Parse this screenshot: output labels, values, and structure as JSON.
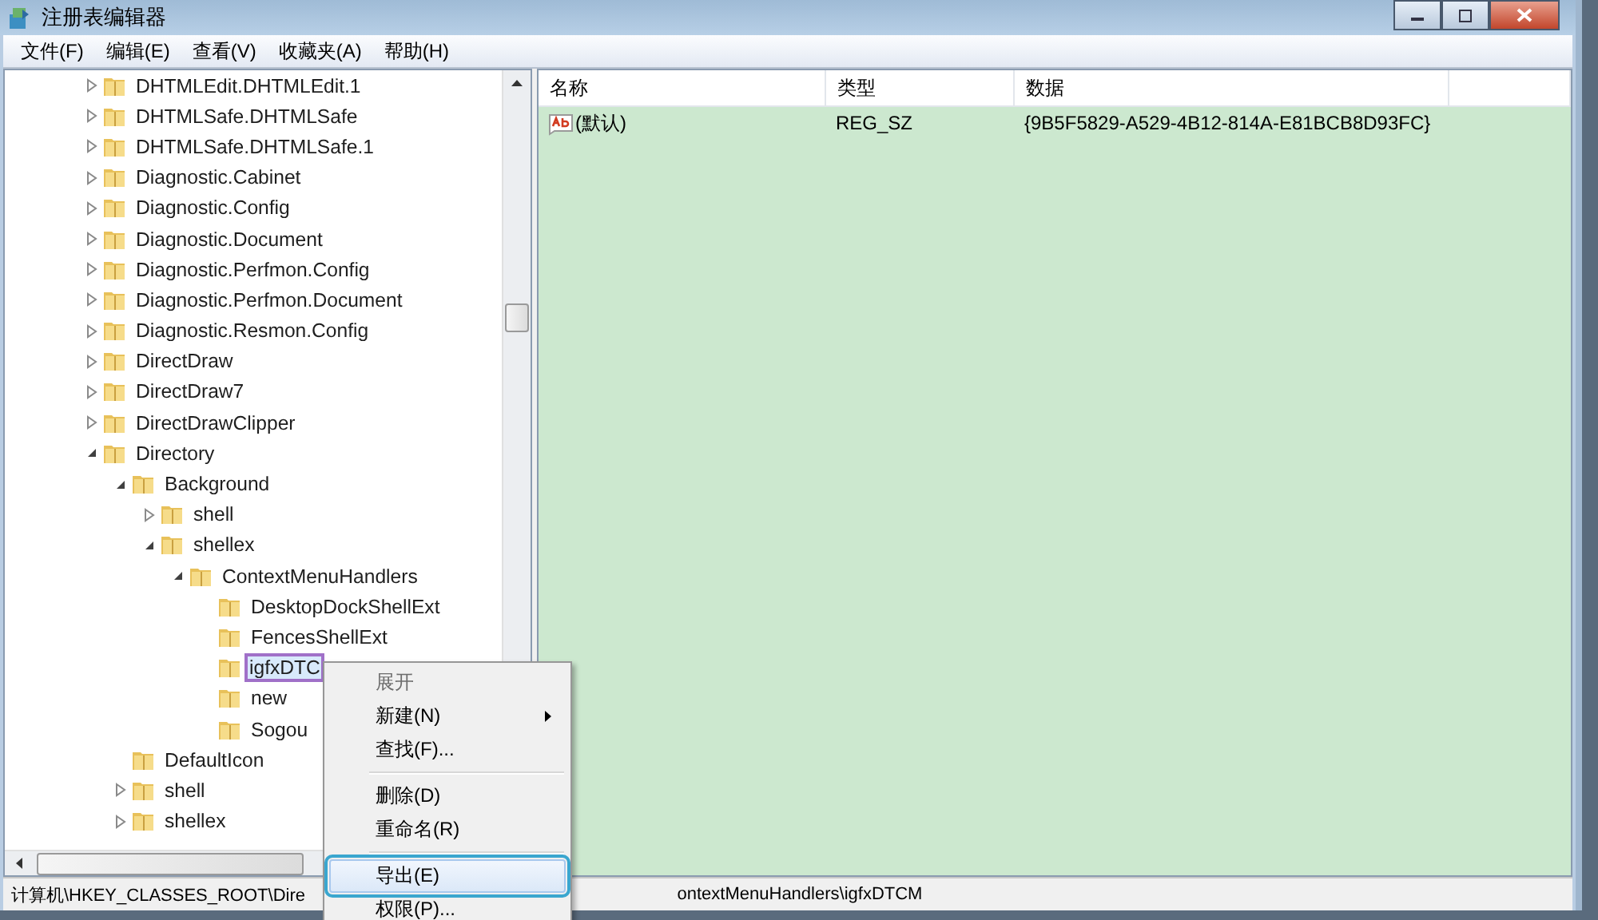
{
  "window": {
    "title": "注册表编辑器"
  },
  "menu_bar": [
    "文件(F)",
    "编辑(E)",
    "查看(V)",
    "收藏夹(A)",
    "帮助(H)"
  ],
  "tree": [
    {
      "label": "DHTMLEdit.DHTMLEdit.1",
      "expandable": true,
      "expanded": false,
      "selected": false
    },
    {
      "label": "DHTMLSafe.DHTMLSafe",
      "expandable": true,
      "expanded": false,
      "selected": false
    },
    {
      "label": "DHTMLSafe.DHTMLSafe.1",
      "expandable": true,
      "expanded": false,
      "selected": false
    },
    {
      "label": "Diagnostic.Cabinet",
      "expandable": true,
      "expanded": false,
      "selected": false
    },
    {
      "label": "Diagnostic.Config",
      "expandable": true,
      "expanded": false,
      "selected": false
    },
    {
      "label": "Diagnostic.Document",
      "expandable": true,
      "expanded": false,
      "selected": false
    },
    {
      "label": "Diagnostic.Perfmon.Config",
      "expandable": true,
      "expanded": false,
      "selected": false
    },
    {
      "label": "Diagnostic.Perfmon.Document",
      "expandable": true,
      "expanded": false,
      "selected": false
    },
    {
      "label": "Diagnostic.Resmon.Config",
      "expandable": true,
      "expanded": false,
      "selected": false
    },
    {
      "label": "DirectDraw",
      "expandable": true,
      "expanded": false,
      "selected": false
    },
    {
      "label": "DirectDraw7",
      "expandable": true,
      "expanded": false,
      "selected": false
    },
    {
      "label": "DirectDrawClipper",
      "expandable": true,
      "expanded": false,
      "selected": false
    },
    {
      "label": "Directory",
      "expandable": true,
      "expanded": true,
      "selected": false,
      "children": [
        {
          "label": "Background",
          "expandable": true,
          "expanded": true,
          "selected": false,
          "children": [
            {
              "label": "shell",
              "expandable": true,
              "expanded": false,
              "selected": false
            },
            {
              "label": "shellex",
              "expandable": true,
              "expanded": true,
              "selected": false,
              "children": [
                {
                  "label": "ContextMenuHandlers",
                  "expandable": true,
                  "expanded": true,
                  "selected": false,
                  "children": [
                    {
                      "label": "DesktopDockShellExt",
                      "expandable": false,
                      "selected": false
                    },
                    {
                      "label": "FencesShellExt",
                      "expandable": false,
                      "selected": false
                    },
                    {
                      "label": "igfxDTC",
                      "expandable": false,
                      "selected": true,
                      "annotated": true
                    },
                    {
                      "label": "new",
                      "expandable": false,
                      "selected": false
                    },
                    {
                      "label": "Sogou",
                      "expandable": false,
                      "selected": false
                    }
                  ]
                }
              ]
            }
          ]
        },
        {
          "label": "DefaultIcon",
          "expandable": false,
          "selected": false
        },
        {
          "label": "shell",
          "expandable": true,
          "expanded": false,
          "selected": false
        },
        {
          "label": "shellex",
          "expandable": true,
          "expanded": false,
          "selected": false
        }
      ]
    }
  ],
  "values": {
    "columns": [
      "名称",
      "类型",
      "数据"
    ],
    "rows": [
      {
        "name": "(默认)",
        "type": "REG_SZ",
        "data": "{9B5F5829-A529-4B12-814A-E81BCB8D93FC}"
      }
    ]
  },
  "context_menu": [
    {
      "kind": "item",
      "label": "展开",
      "disabled": true,
      "selected": false
    },
    {
      "kind": "submenu",
      "label": "新建(N)",
      "disabled": false,
      "selected": false
    },
    {
      "kind": "item",
      "label": "查找(F)...",
      "disabled": false,
      "selected": false
    },
    {
      "kind": "separator"
    },
    {
      "kind": "item",
      "label": "删除(D)",
      "disabled": false,
      "selected": false
    },
    {
      "kind": "item",
      "label": "重命名(R)",
      "disabled": false,
      "selected": false
    },
    {
      "kind": "separator"
    },
    {
      "kind": "item",
      "label": "导出(E)",
      "disabled": false,
      "selected": true,
      "annotated": true
    },
    {
      "kind": "item",
      "label": "权限(P)...",
      "disabled": false,
      "selected": false
    }
  ],
  "status_bar": {
    "left": "计算机\\HKEY_CLASSES_ROOT\\Dire",
    "right": "ontextMenuHandlers\\igfxDTCM"
  }
}
